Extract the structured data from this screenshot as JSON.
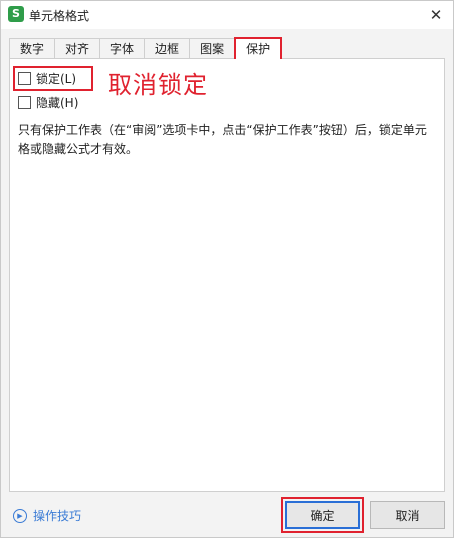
{
  "window": {
    "title": "单元格格式",
    "app_icon_letter": "S"
  },
  "tabs": [
    {
      "label": "数字",
      "active": false
    },
    {
      "label": "对齐",
      "active": false
    },
    {
      "label": "字体",
      "active": false
    },
    {
      "label": "边框",
      "active": false
    },
    {
      "label": "图案",
      "active": false
    },
    {
      "label": "保护",
      "active": true
    }
  ],
  "protection": {
    "lock_label": "锁定(L)",
    "lock_checked": false,
    "hidden_label": "隐藏(H)",
    "hidden_checked": false,
    "description": "只有保护工作表（在“审阅”选项卡中，点击“保护工作表”按钮）后，锁定单元格或隐藏公式才有效。"
  },
  "annotation": {
    "text": "取消锁定",
    "color": "#e0222f"
  },
  "footer": {
    "tips_label": "操作技巧",
    "ok_label": "确定",
    "cancel_label": "取消"
  },
  "icons": {
    "app": "spreadsheet-app-icon",
    "close": "close-icon",
    "tips": "play-circle-icon"
  },
  "colors": {
    "highlight": "#e0222f",
    "link": "#3a7bd5",
    "focus": "#2a6fd6",
    "app_icon": "#2f9d4a"
  }
}
